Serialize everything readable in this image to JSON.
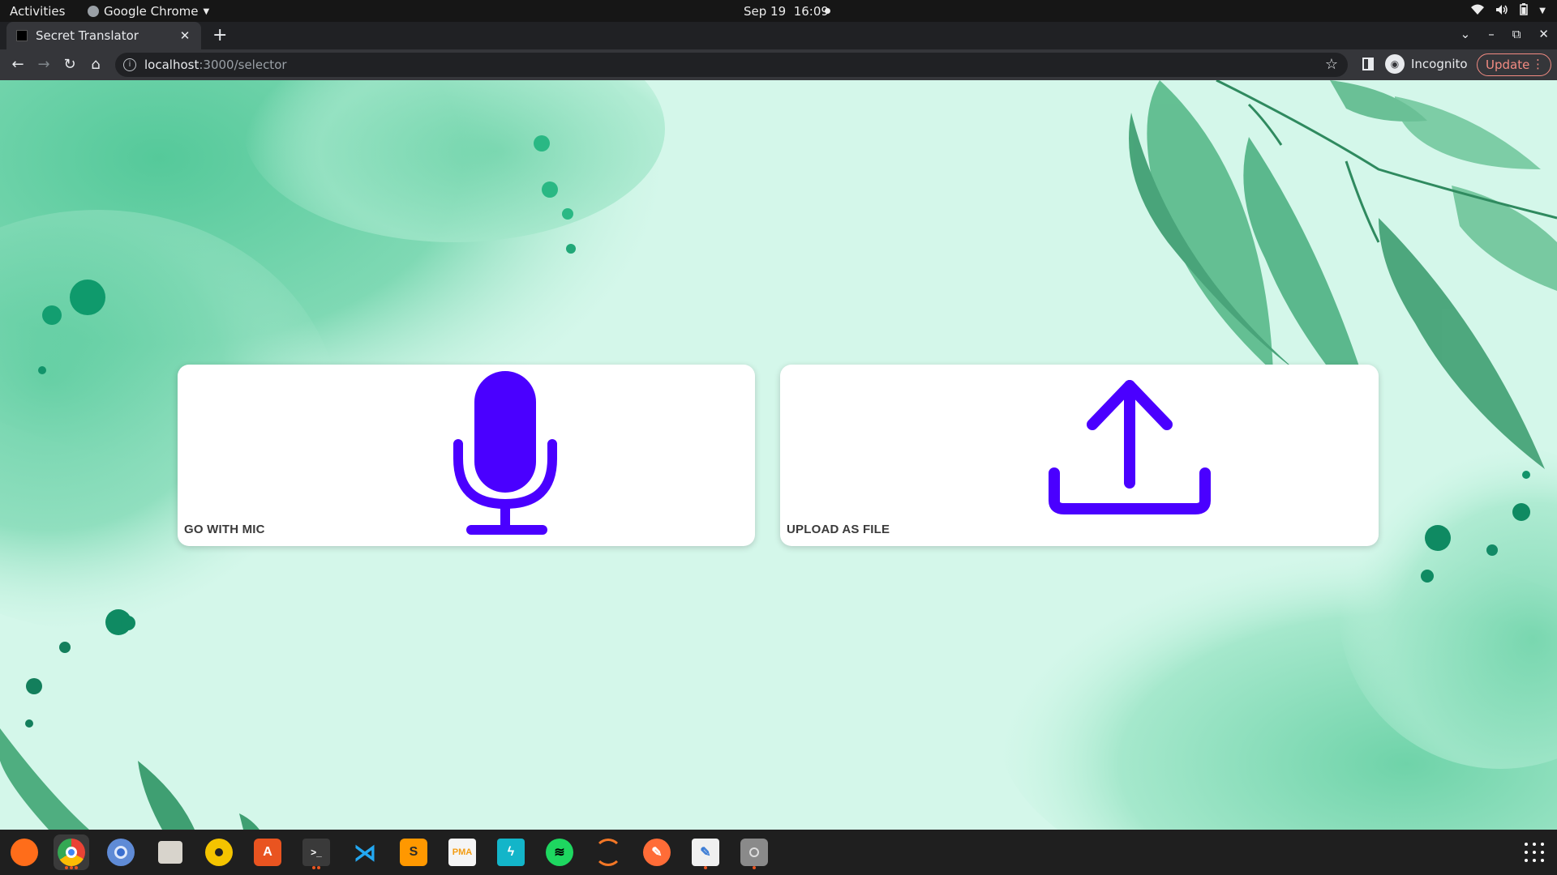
{
  "system_bar": {
    "activities": "Activities",
    "app_name": "Google Chrome",
    "date": "Sep 19",
    "time": "16:09"
  },
  "browser": {
    "tab_title": "Secret Translator",
    "url_host": "localhost",
    "url_path": ":3000/selector",
    "profile": "Incognito",
    "update_label": "Update"
  },
  "page": {
    "cards": [
      {
        "label": "GO WITH MIC",
        "icon": "microphone-icon"
      },
      {
        "label": "UPLOAD AS FILE",
        "icon": "upload-icon"
      }
    ],
    "accent_color": "#4a00ff",
    "background_color": "#d4f7ea"
  },
  "dock": {
    "apps": [
      "firefox-icon",
      "chrome-icon",
      "chromium-icon",
      "files-icon",
      "rhythmbox-icon",
      "app-store-icon",
      "terminal-icon",
      "vscode-icon",
      "sublime-text-icon",
      "phpmyadmin-icon",
      "bolt-icon",
      "spotify-icon",
      "jupyter-icon",
      "postman-icon",
      "text-editor-icon",
      "disk-icon"
    ]
  }
}
